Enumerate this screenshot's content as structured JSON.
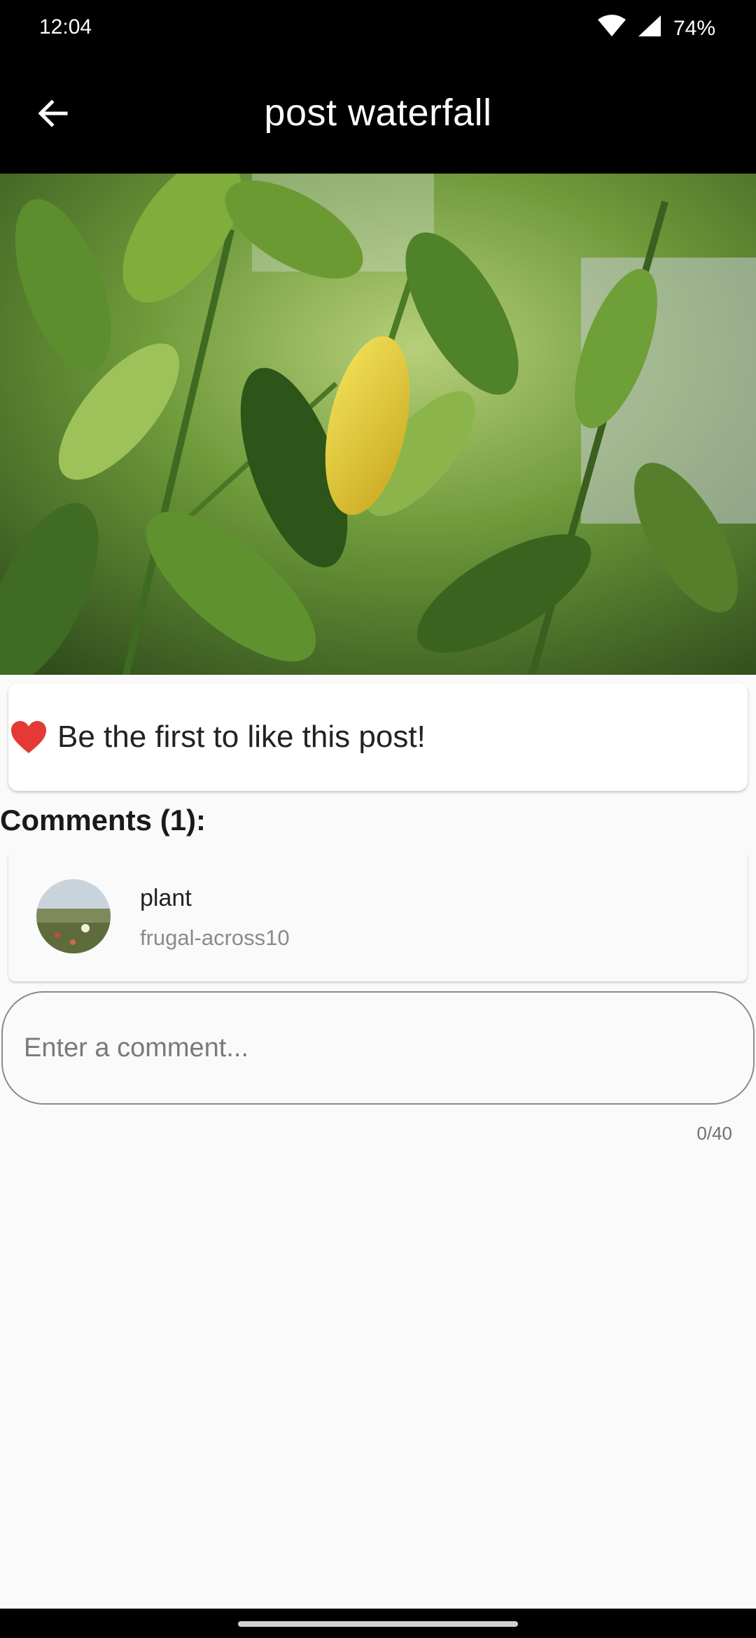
{
  "status_bar": {
    "time": "12:04",
    "battery": "74%"
  },
  "app_bar": {
    "title": "post waterfall",
    "back_icon": "arrow-left-icon"
  },
  "post": {
    "image": "photo of green citrus leaves with one yellow leaf"
  },
  "likes": {
    "icon": "heart-icon",
    "text": "Be the first to like this post!"
  },
  "comments": {
    "heading": "Comments (1):",
    "items": [
      {
        "title": "plant",
        "username": "frugal-across10"
      }
    ]
  },
  "comment_input": {
    "placeholder": "Enter a comment...",
    "counter": "0/40"
  },
  "colors": {
    "bar": "#000000",
    "background": "#fafafa",
    "heart": "#e53935"
  }
}
